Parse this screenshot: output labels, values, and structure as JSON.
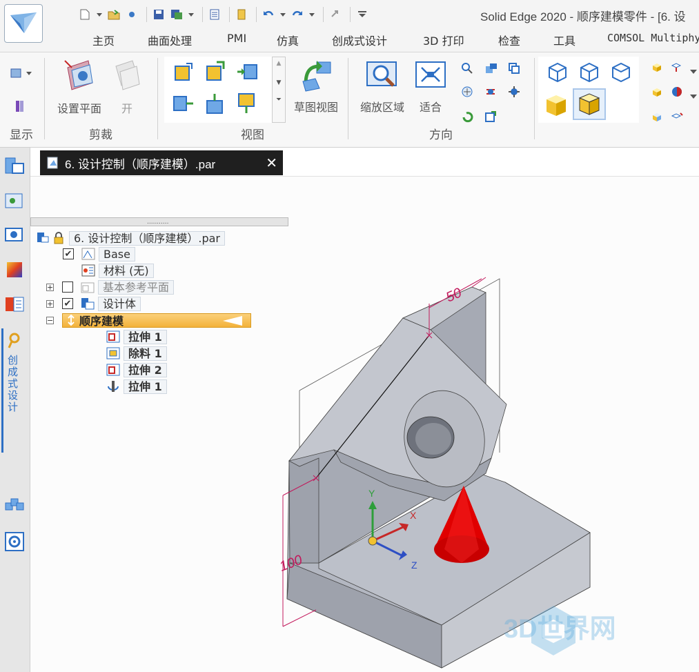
{
  "window": {
    "title": "Solid Edge 2020 - 顺序建模零件 - [6. 设"
  },
  "menu_tabs": [
    "主页",
    "曲面处理",
    "PMI",
    "仿真",
    "创成式设计",
    "3D 打印",
    "检查",
    "工具",
    "COMSOL Multiphy"
  ],
  "ribbon": {
    "groups": {
      "display": "显示",
      "clip": "剪裁",
      "view": "视图",
      "orient": "方向"
    },
    "buttons": {
      "set_plane": "设置平面",
      "open": "开",
      "sketch_view": "草图视图",
      "zoom_area": "缩放区域",
      "fit": "适合"
    }
  },
  "document_tab": {
    "title": "6. 设计控制（顺序建模）.par",
    "close_glyph": "✕"
  },
  "left_toolbar": {
    "vertical_tab_label": "创成式设计"
  },
  "pathfinder": {
    "grip": "...........",
    "root": "6. 设计控制（顺序建模）.par",
    "items": [
      {
        "label": "Base",
        "checked": true
      },
      {
        "label": "材料 (无)"
      },
      {
        "label": "基本参考平面",
        "checked": false,
        "expander": "+"
      },
      {
        "label": "设计体",
        "checked": true,
        "expander": "+"
      },
      {
        "label": "顺序建模",
        "expander": "−"
      }
    ],
    "features": [
      "拉伸 1",
      "除料 1",
      "拉伸 2",
      "拉伸 1"
    ]
  },
  "model": {
    "dim_top": "50",
    "dim_left": "100",
    "axis_x": "X",
    "axis_y": "Y",
    "axis_z": "Z"
  },
  "watermark": "3D世界网",
  "colors": {
    "accent_blue": "#2d6fc4",
    "highlight_orange": "#f3b23a",
    "part_gray": "#b9bcc4",
    "dimension_magenta": "#c2185b",
    "cone_red": "#e00000"
  }
}
